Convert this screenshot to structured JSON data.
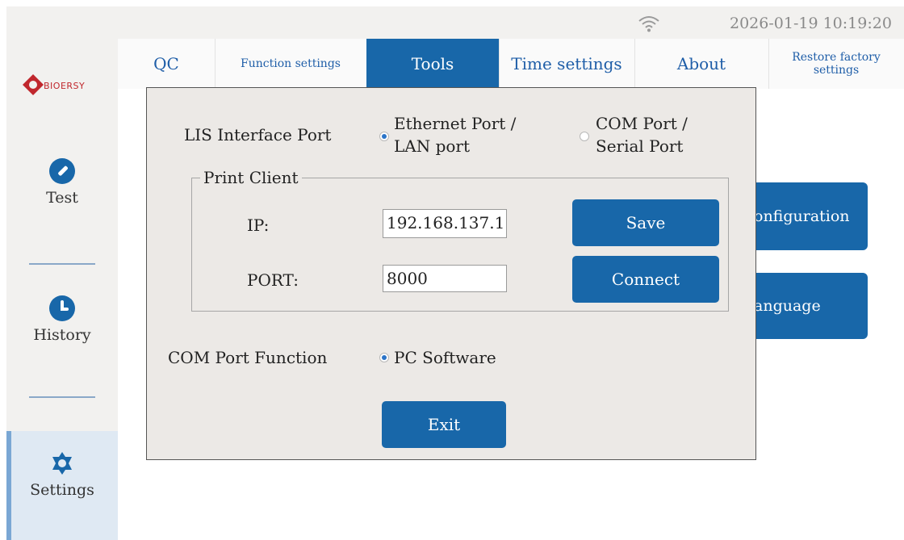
{
  "status": {
    "datetime": "2026-01-19 10:19:20",
    "wifi_icon": "wifi-icon"
  },
  "brand": {
    "logo_text": "BIOERSY",
    "color": "#c0272d"
  },
  "sidebar": {
    "items": [
      {
        "label": "Test",
        "icon": "pencil-icon"
      },
      {
        "label": "History",
        "icon": "clock-icon"
      },
      {
        "label": "Settings",
        "icon": "gear-icon",
        "active": true
      }
    ]
  },
  "tabs": [
    {
      "label": "QC"
    },
    {
      "label": "Function settings"
    },
    {
      "label": "Tools",
      "active": true
    },
    {
      "label": "Time settings"
    },
    {
      "label": "About"
    },
    {
      "label": "Restore factory settings"
    }
  ],
  "background": {
    "btn1": "onfiguration",
    "btn2": "anguage"
  },
  "dialog": {
    "lis_label": "LIS Interface Port",
    "lis_options": [
      {
        "label": "Ethernet Port / LAN port",
        "line1": "Ethernet Port /",
        "line2": "LAN port",
        "checked": true
      },
      {
        "label": "COM Port / Serial Port",
        "line1": "COM Port /",
        "line2": "Serial Port",
        "checked": false
      }
    ],
    "print_client": {
      "title": "Print Client",
      "ip_label": "IP:",
      "ip_value": "192.168.137.1",
      "port_label": "PORT:",
      "port_value": "8000",
      "save_label": "Save",
      "connect_label": "Connect"
    },
    "com_label": "COM Port Function",
    "com_option": {
      "label": "PC Software",
      "checked": true
    },
    "exit_label": "Exit"
  },
  "colors": {
    "accent": "#1867a9",
    "active_bg": "#dfe9f3",
    "dialog_bg": "#ece9e6"
  }
}
